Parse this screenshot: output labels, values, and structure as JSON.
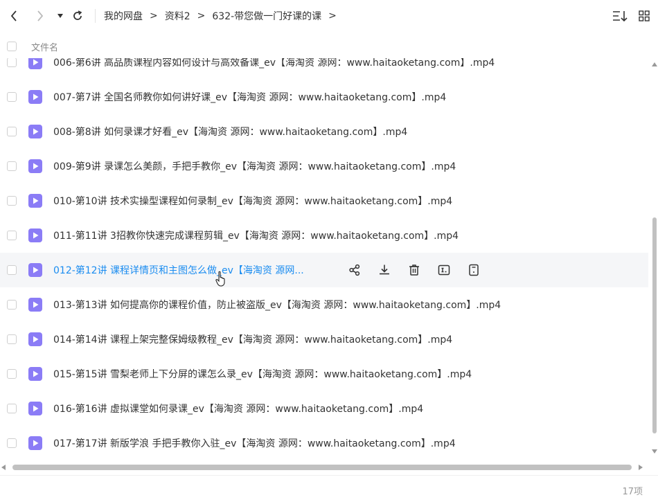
{
  "toolbar": {
    "breadcrumb": [
      "我的网盘",
      "资料2",
      "632-带您做一门好课的课"
    ],
    "crumb_separator": ">"
  },
  "list_header": {
    "name_label": "文件名"
  },
  "files": [
    "006-第6讲 高品质课程内容如何设计与高效备课_ev【海淘资 源网：www.haitaoketang.com】.mp4",
    "007-第7讲 全国名师教你如何讲好课_ev【海淘资 源网：www.haitaoketang.com】.mp4",
    "008-第8讲 如何录课才好看_ev【海淘资 源网：www.haitaoketang.com】.mp4",
    "009-第9讲 录课怎么美颜，手把手教你_ev【海淘资 源网：www.haitaoketang.com】.mp4",
    "010-第10讲 技术实操型课程如何录制_ev【海淘资 源网：www.haitaoketang.com】.mp4",
    "011-第11讲 3招教你快速完成课程剪辑_ev【海淘资 源网：www.haitaoketang.com】.mp4",
    "012-第12讲 课程详情页和主图怎么做_ev【海淘资 源网...",
    "013-第13讲 如何提高你的课程价值，防止被盗版_ev【海淘资 源网：www.haitaoketang.com】.mp4",
    "014-第14讲 课程上架完整保姆级教程_ev【海淘资 源网：www.haitaoketang.com】.mp4",
    "015-第15讲 雪梨老师上下分屏的课怎么录_ev【海淘资 源网：www.haitaoketang.com】.mp4",
    "016-第16讲 虚拟课堂如何录课_ev【海淘资 源网：www.haitaoketang.com】.mp4",
    "017-第17讲 新版学浪 手把手教你入驻_ev【海淘资 源网：www.haitaoketang.com】.mp4"
  ],
  "status": {
    "count": "17项"
  },
  "colors": {
    "accent": "#1a8cf0",
    "video_icon": "#8b7cf6"
  }
}
